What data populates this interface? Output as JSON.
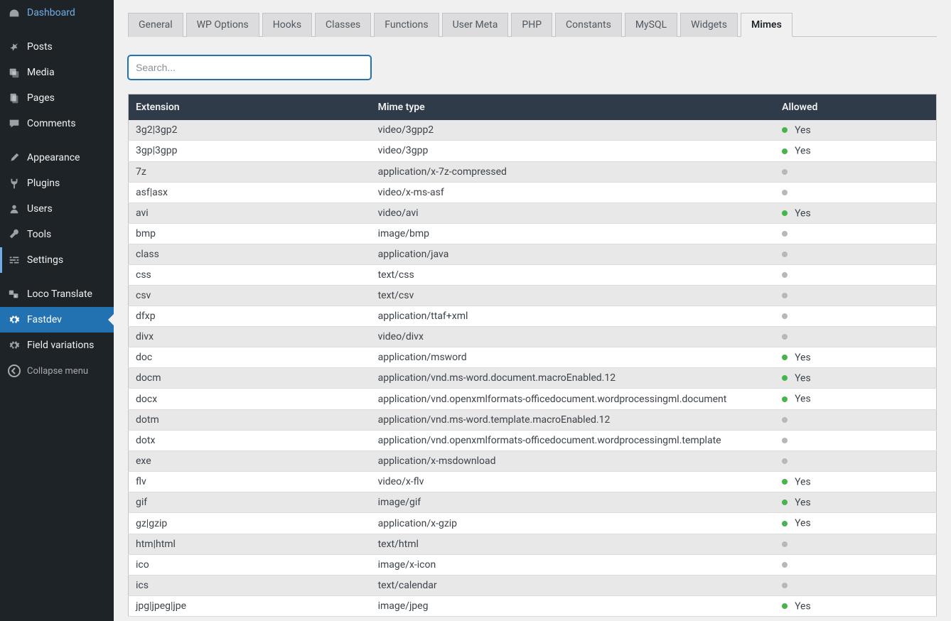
{
  "sidebar": {
    "items": [
      {
        "label": "Dashboard",
        "icon": "dashboard"
      },
      {
        "label": "Posts",
        "icon": "pin"
      },
      {
        "label": "Media",
        "icon": "media"
      },
      {
        "label": "Pages",
        "icon": "pages"
      },
      {
        "label": "Comments",
        "icon": "comment"
      },
      {
        "label": "Appearance",
        "icon": "brush"
      },
      {
        "label": "Plugins",
        "icon": "plug"
      },
      {
        "label": "Users",
        "icon": "user"
      },
      {
        "label": "Tools",
        "icon": "wrench"
      },
      {
        "label": "Settings",
        "icon": "sliders"
      },
      {
        "label": "Loco Translate",
        "icon": "translate"
      },
      {
        "label": "Fastdev",
        "icon": "gear"
      },
      {
        "label": "Field variations",
        "icon": "gear"
      }
    ],
    "collapse_label": "Collapse menu"
  },
  "tabs": [
    "General",
    "WP Options",
    "Hooks",
    "Classes",
    "Functions",
    "User Meta",
    "PHP",
    "Constants",
    "MySQL",
    "Widgets",
    "Mimes"
  ],
  "active_tab": "Mimes",
  "search": {
    "placeholder": "Search...",
    "value": ""
  },
  "table": {
    "headers": [
      "Extension",
      "Mime type",
      "Allowed"
    ],
    "yes_label": "Yes",
    "rows": [
      {
        "ext": "3g2|3gp2",
        "mime": "video/3gpp2",
        "allowed": true
      },
      {
        "ext": "3gp|3gpp",
        "mime": "video/3gpp",
        "allowed": true
      },
      {
        "ext": "7z",
        "mime": "application/x-7z-compressed",
        "allowed": false
      },
      {
        "ext": "asf|asx",
        "mime": "video/x-ms-asf",
        "allowed": false
      },
      {
        "ext": "avi",
        "mime": "video/avi",
        "allowed": true
      },
      {
        "ext": "bmp",
        "mime": "image/bmp",
        "allowed": false
      },
      {
        "ext": "class",
        "mime": "application/java",
        "allowed": false
      },
      {
        "ext": "css",
        "mime": "text/css",
        "allowed": false
      },
      {
        "ext": "csv",
        "mime": "text/csv",
        "allowed": false
      },
      {
        "ext": "dfxp",
        "mime": "application/ttaf+xml",
        "allowed": false
      },
      {
        "ext": "divx",
        "mime": "video/divx",
        "allowed": false
      },
      {
        "ext": "doc",
        "mime": "application/msword",
        "allowed": true
      },
      {
        "ext": "docm",
        "mime": "application/vnd.ms-word.document.macroEnabled.12",
        "allowed": true
      },
      {
        "ext": "docx",
        "mime": "application/vnd.openxmlformats-officedocument.wordprocessingml.document",
        "allowed": true
      },
      {
        "ext": "dotm",
        "mime": "application/vnd.ms-word.template.macroEnabled.12",
        "allowed": false
      },
      {
        "ext": "dotx",
        "mime": "application/vnd.openxmlformats-officedocument.wordprocessingml.template",
        "allowed": false
      },
      {
        "ext": "exe",
        "mime": "application/x-msdownload",
        "allowed": false
      },
      {
        "ext": "flv",
        "mime": "video/x-flv",
        "allowed": true
      },
      {
        "ext": "gif",
        "mime": "image/gif",
        "allowed": true
      },
      {
        "ext": "gz|gzip",
        "mime": "application/x-gzip",
        "allowed": true
      },
      {
        "ext": "htm|html",
        "mime": "text/html",
        "allowed": false
      },
      {
        "ext": "ico",
        "mime": "image/x-icon",
        "allowed": false
      },
      {
        "ext": "ics",
        "mime": "text/calendar",
        "allowed": false
      },
      {
        "ext": "jpg|jpeg|jpe",
        "mime": "image/jpeg",
        "allowed": true
      }
    ]
  }
}
